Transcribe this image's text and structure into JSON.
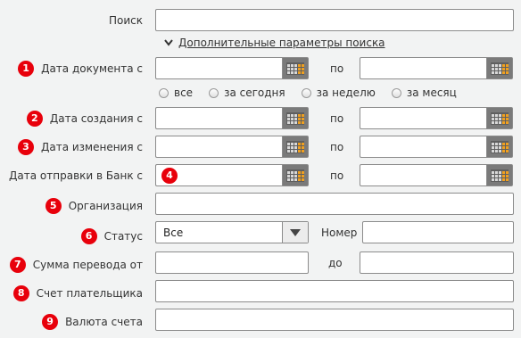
{
  "search": {
    "label": "Поиск",
    "value": ""
  },
  "advanced": {
    "label": "Дополнительные параметры поиска",
    "icon": "chevron-down-icon"
  },
  "badges": [
    "1",
    "2",
    "3",
    "4",
    "5",
    "6",
    "7",
    "8",
    "9"
  ],
  "doc_date": {
    "label": "Дата документа с",
    "to_label": "по",
    "from_value": "",
    "to_value": ""
  },
  "period": {
    "options": [
      "все",
      "за сегодня",
      "за неделю",
      "за месяц"
    ]
  },
  "created_date": {
    "label": "Дата создания с",
    "to_label": "по"
  },
  "modified_date": {
    "label": "Дата изменения с",
    "to_label": "по"
  },
  "sent_date": {
    "label": "Дата отправки в Банк с",
    "to_label": "по"
  },
  "organization": {
    "label": "Организация",
    "value": ""
  },
  "status": {
    "label": "Статус",
    "value": "Все"
  },
  "number": {
    "label": "Номер",
    "value": ""
  },
  "amount": {
    "label": "Сумма перевода от",
    "to_label": "до",
    "from_value": "",
    "to_value": ""
  },
  "payer_account": {
    "label": "Счет плательщика",
    "value": ""
  },
  "account_currency": {
    "label": "Валюта счета",
    "value": ""
  },
  "colors": {
    "badge": "#e8000b",
    "calendar_button": "#7a7a7a",
    "calendar_orange": "#f0a020"
  }
}
